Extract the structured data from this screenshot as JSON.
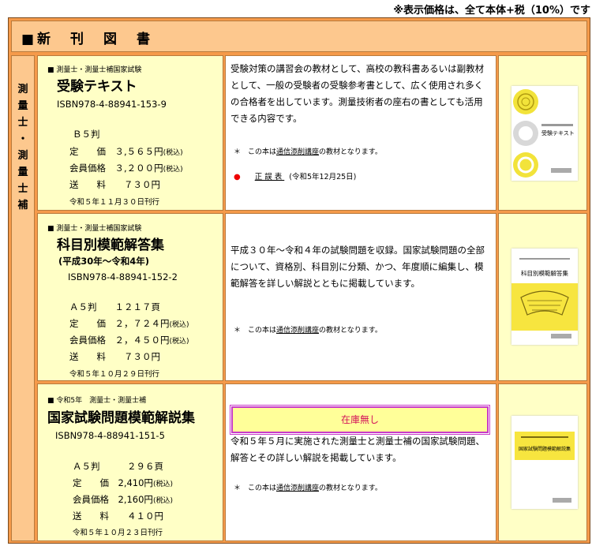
{
  "tax_note": "※表示価格は、全て本体+税（10%）です",
  "header_title": "■新　刊　図　書",
  "category_chars": [
    "測",
    "量",
    "士",
    "・",
    "測",
    "量",
    "士",
    "補"
  ],
  "books": [
    {
      "category": "測量士・測量士補国家試験",
      "title": "受験テキスト",
      "subtitle": "",
      "isbn": "ISBN978-4-88941-153-9",
      "format": "Ｂ５判",
      "pages": "",
      "price_label": "定　　価",
      "price": "３,５６５円",
      "member_label": "会員価格",
      "member_price": "３,２００円",
      "tax_tag": "(税込)",
      "shipping_label": "送　　料",
      "shipping": "７３０円",
      "date": "令和５年１１月３０日刊行",
      "description": "受験対策の講習会の教材として、高校の教科書あるいは副教材として、一般の受験者の受験参考書として、広く使用され多くの合格者を出しています。測量技術者の座右の書としても活用できる内容です。",
      "note_prefix": "＊　この本は",
      "note_link": "通信添削講座",
      "note_suffix": "の教材となります。",
      "errata_label": "正誤表",
      "errata_date": "(令和5年12月25日)",
      "stock": "",
      "cover_title": "受験テキスト"
    },
    {
      "category": "測量士・測量士補国家試験",
      "title": "科目別模範解答集",
      "subtitle": "(平成30年〜令和4年)",
      "isbn": "ISBN978-4-88941-152-2",
      "format": "Ａ５判",
      "pages": "１２１７頁",
      "price_label": "定　　価",
      "price": "２，７２４円",
      "member_label": "会員価格",
      "member_price": "２，４５０円",
      "tax_tag": "(税込)",
      "shipping_label": "送　　料",
      "shipping": "７３０円",
      "date": "令和５年１０月２９日刊行",
      "description": "平成３０年〜令和４年の試験問題を収録。国家試験問題の全部について、資格別、科目別に分類、かつ、年度順に編集し、模範解答を詳しい解説とともに掲載しています。",
      "note_prefix": "＊　この本は",
      "note_link": "通信添削講座",
      "note_suffix": "の教材となります。",
      "errata_label": "",
      "errata_date": "",
      "stock": "",
      "cover_title": "科目別模範解答集"
    },
    {
      "category": "令和5年　測量士・測量士補",
      "title": "国家試験問題模範解説集",
      "subtitle": "",
      "isbn": "ISBN978-4-88941-151-5",
      "format": "Ａ５判",
      "pages": "２９６頁",
      "price_label": "定　　価",
      "price": "2,410円",
      "member_label": "会員価格",
      "member_price": "2,160円",
      "tax_tag": "(税込)",
      "shipping_label": "送　　料",
      "shipping": "４１０円",
      "date": "令和５年１０月２３日刊行",
      "description": "令和５年５月に実施された測量士と測量士補の国家試験問題、解答とその詳しい解説を掲載しています。",
      "note_prefix": "＊　この本は",
      "note_link": "通信添削講座",
      "note_suffix": "の教材となります。",
      "errata_label": "",
      "errata_date": "",
      "stock": "在庫無し",
      "cover_title": "国家試験問題模範解説集"
    }
  ],
  "colors": {
    "frame": "#f59a4a",
    "header": "#fdc88e",
    "info": "#ffffc6",
    "stock_text": "#d4145a",
    "stock_border": "#c83cc8"
  }
}
